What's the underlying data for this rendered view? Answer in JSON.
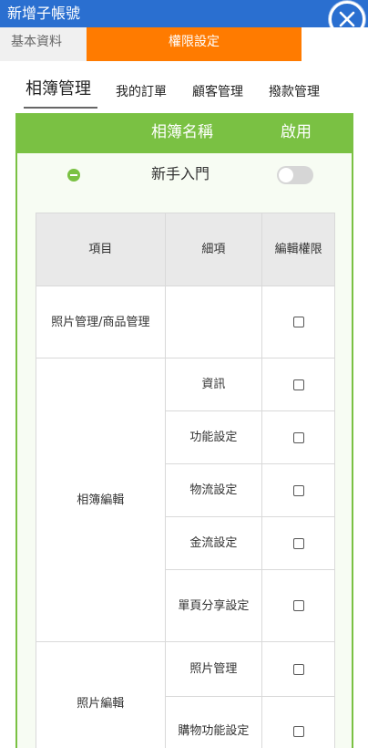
{
  "header": {
    "title": "新增子帳號",
    "close_icon": "close-icon"
  },
  "main_tabs": [
    {
      "label": "基本資料",
      "active": false
    },
    {
      "label": "權限設定",
      "active": true
    }
  ],
  "sub_tabs": [
    {
      "label": "相簿管理",
      "active": true
    },
    {
      "label": "我的訂單",
      "active": false
    },
    {
      "label": "顧客管理",
      "active": false
    },
    {
      "label": "撥款管理",
      "active": false
    }
  ],
  "album_panel": {
    "col_name": "相簿名稱",
    "col_enable": "啟用",
    "album": {
      "name": "新手入門",
      "enabled": false,
      "collapse_icon": "minus-circle-icon"
    }
  },
  "permission_table": {
    "headers": {
      "item": "項目",
      "detail": "細項",
      "edit": "編輯權限"
    },
    "rows": [
      {
        "item": "照片管理/商品管理",
        "detail": "",
        "checked": false
      },
      {
        "item": "相簿編輯",
        "detail": "資訊",
        "checked": false
      },
      {
        "item": "",
        "detail": "功能設定",
        "checked": false
      },
      {
        "item": "",
        "detail": "物流設定",
        "checked": false
      },
      {
        "item": "",
        "detail": "金流設定",
        "checked": false
      },
      {
        "item": "",
        "detail": "單頁分享設定",
        "checked": false
      },
      {
        "item": "照片編輯",
        "detail": "照片管理",
        "checked": false
      },
      {
        "item": "",
        "detail": "購物功能設定",
        "checked": false
      }
    ]
  },
  "colors": {
    "titlebar": "#2a6fd0",
    "active_tab": "#ff7b00",
    "accent_green": "#7ac143"
  }
}
